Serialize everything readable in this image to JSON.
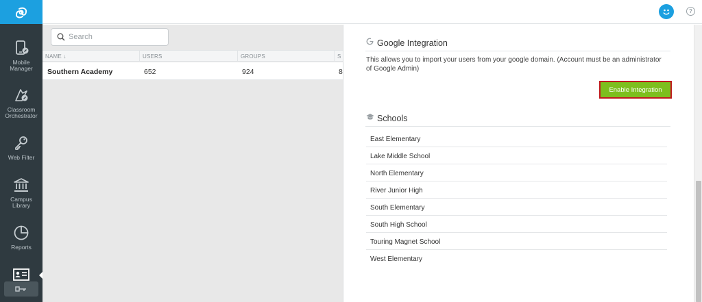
{
  "colors": {
    "sidebar_bg": "#2f3a40",
    "brand_blue": "#1ca0e0",
    "enable_button_bg": "#7dbf1e",
    "enable_button_border": "#c0191e"
  },
  "sidebar": {
    "logo_icon": "brand-logo-icon",
    "items": [
      {
        "label": "Mobile\nManager",
        "icon": "mobile-manager-icon"
      },
      {
        "label": "Classroom\nOrchestrator",
        "icon": "classroom-orchestrator-icon"
      },
      {
        "label": "Web Filter",
        "icon": "key-icon"
      },
      {
        "label": "Campus\nLibrary",
        "icon": "library-icon"
      },
      {
        "label": "Reports",
        "icon": "pie-chart-icon"
      },
      {
        "label": "",
        "icon": "id-card-icon"
      }
    ]
  },
  "search": {
    "placeholder": "Search",
    "value": ""
  },
  "table": {
    "columns": [
      "NAME ↓",
      "USERS",
      "GROUPS",
      "S"
    ],
    "rows": [
      {
        "name": "Southern Academy",
        "users": "652",
        "groups": "924",
        "extra": "8"
      }
    ]
  },
  "google": {
    "title": "Google Integration",
    "description": "This allows you to import your users from your google domain. (Account must be an administrator of Google Admin)",
    "button_label": "Enable Integration"
  },
  "schools": {
    "title": "Schools",
    "items": [
      "East Elementary",
      "Lake Middle School",
      "North Elementary",
      "River Junior High",
      "South Elementary",
      "South High School",
      "Touring Magnet School",
      "West Elementary"
    ]
  }
}
